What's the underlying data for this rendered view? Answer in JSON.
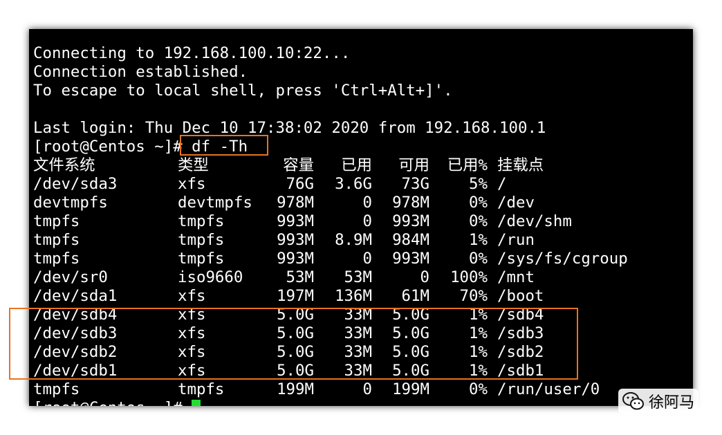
{
  "terminal": {
    "lines": [
      "Connecting to 192.168.100.10:22...",
      "Connection established.",
      "To escape to local shell, press 'Ctrl+Alt+]'.",
      "",
      "Last login: Thu Dec 10 17:38:02 2020 from 192.168.100.1",
      "[root@Centos ~]# df -Th"
    ],
    "df_header": [
      "文件系统",
      "类型",
      "容量",
      "已用",
      "可用",
      "已用%",
      "挂载点"
    ],
    "df_rows": [
      [
        "/dev/sda3",
        "xfs",
        "76G",
        "3.6G",
        "73G",
        "5%",
        "/"
      ],
      [
        "devtmpfs",
        "devtmpfs",
        "978M",
        "0",
        "978M",
        "0%",
        "/dev"
      ],
      [
        "tmpfs",
        "tmpfs",
        "993M",
        "0",
        "993M",
        "0%",
        "/dev/shm"
      ],
      [
        "tmpfs",
        "tmpfs",
        "993M",
        "8.9M",
        "984M",
        "1%",
        "/run"
      ],
      [
        "tmpfs",
        "tmpfs",
        "993M",
        "0",
        "993M",
        "0%",
        "/sys/fs/cgroup"
      ],
      [
        "/dev/sr0",
        "iso9660",
        "53M",
        "53M",
        "0",
        "100%",
        "/mnt"
      ],
      [
        "/dev/sda1",
        "xfs",
        "197M",
        "136M",
        "61M",
        "70%",
        "/boot"
      ],
      [
        "/dev/sdb4",
        "xfs",
        "5.0G",
        "33M",
        "5.0G",
        "1%",
        "/sdb4"
      ],
      [
        "/dev/sdb3",
        "xfs",
        "5.0G",
        "33M",
        "5.0G",
        "1%",
        "/sdb3"
      ],
      [
        "/dev/sdb2",
        "xfs",
        "5.0G",
        "33M",
        "5.0G",
        "1%",
        "/sdb2"
      ],
      [
        "/dev/sdb1",
        "xfs",
        "5.0G",
        "33M",
        "5.0G",
        "1%",
        "/sdb1"
      ],
      [
        "tmpfs",
        "tmpfs",
        "199M",
        "0",
        "199M",
        "0%",
        "/run/user/0"
      ]
    ],
    "final_prompt": "[root@Centos ~]# ",
    "cursor_color": "#22dd33",
    "highlight_color": "#e8731f"
  },
  "watermark": {
    "icon": "wechat-icon",
    "text": "徐阿马"
  }
}
